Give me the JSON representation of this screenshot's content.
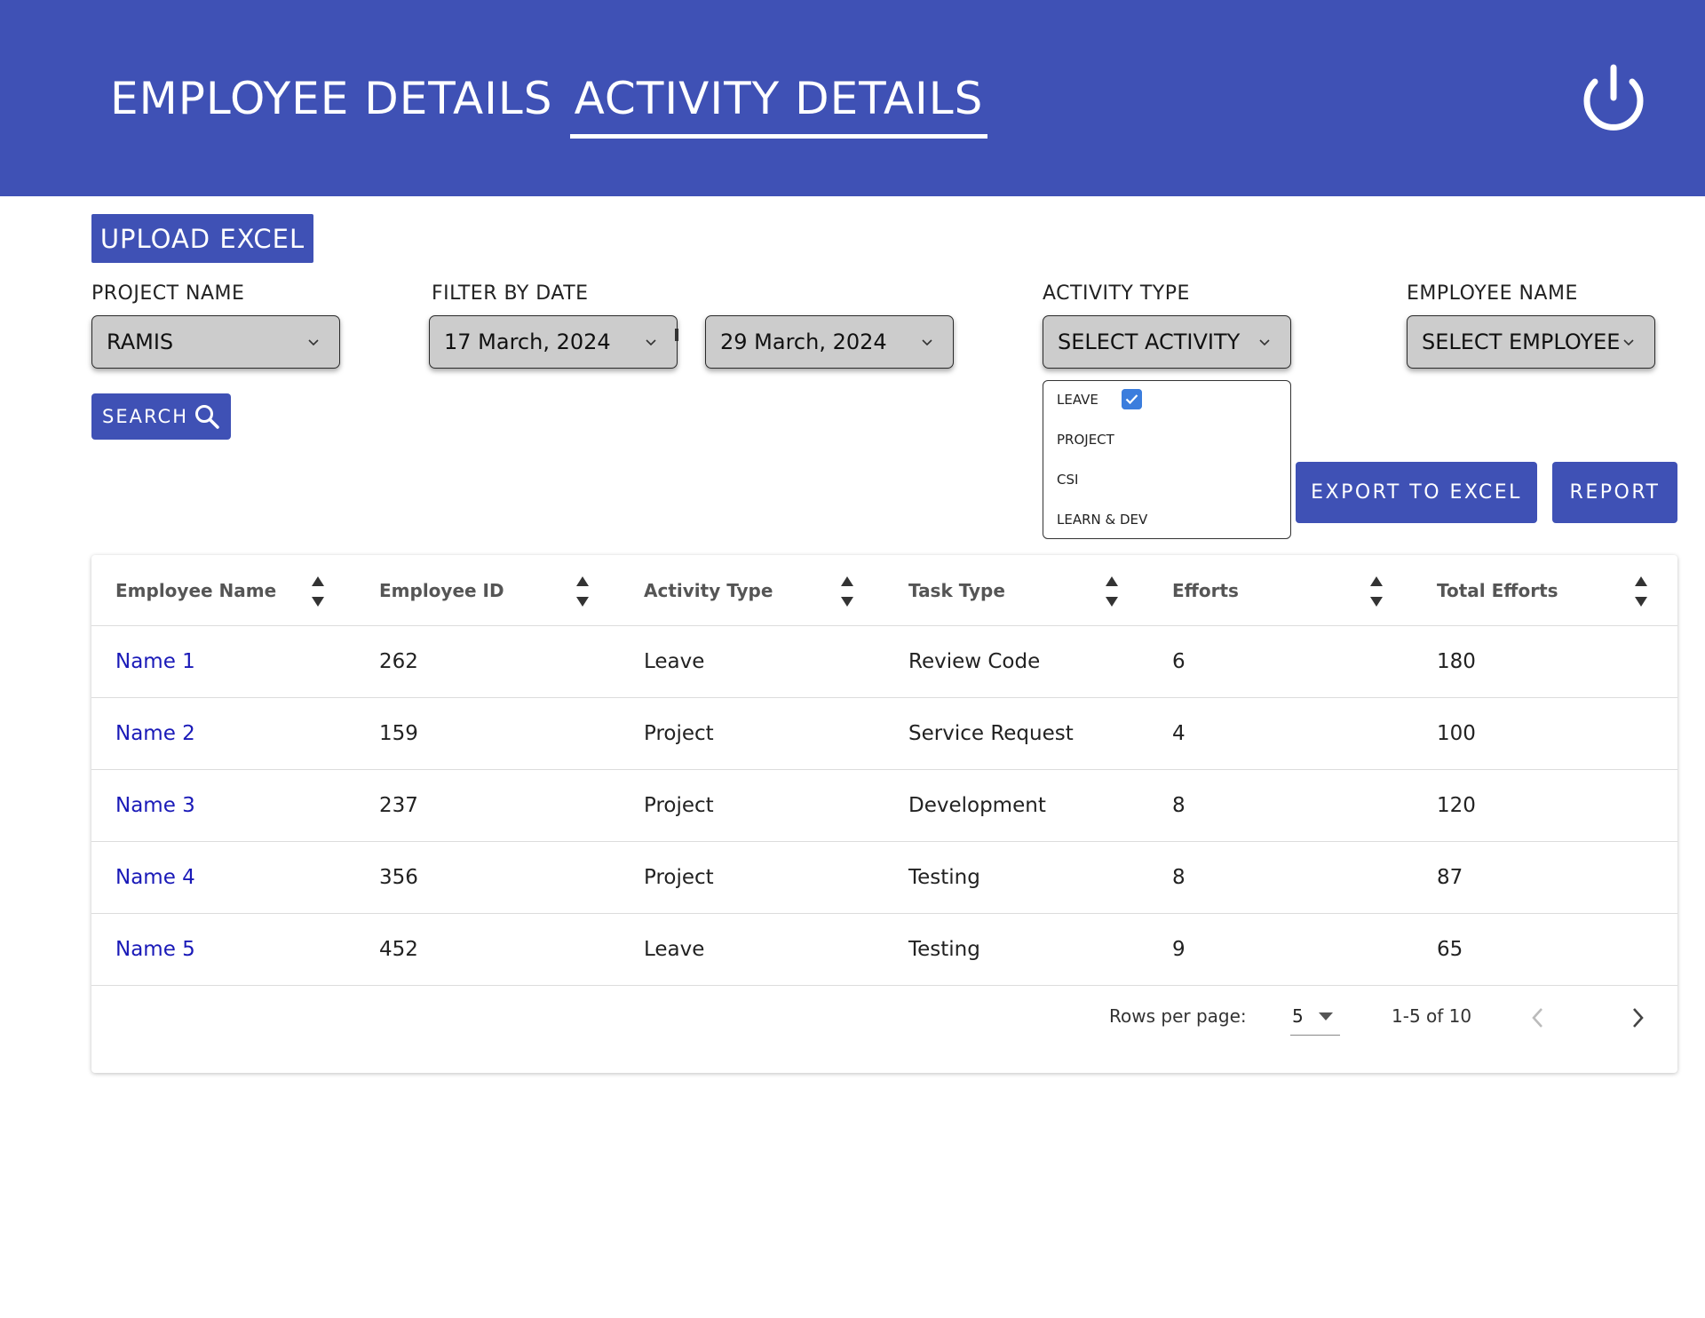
{
  "header": {
    "tabs": [
      {
        "label": "EMPLOYEE DETAILS",
        "active": false
      },
      {
        "label": "ACTIVITY DETAILS",
        "active": true
      }
    ],
    "power_icon": "power-icon",
    "accent_color": "#3f51b5"
  },
  "toolbar": {
    "upload_label": "UPLOAD EXCEL",
    "search_label": "SEARCH",
    "export_label": "EXPORT TO EXCEL",
    "report_label": "REPORT"
  },
  "filters": {
    "project": {
      "label": "PROJECT NAME",
      "value": "RAMIS"
    },
    "date": {
      "label": "FILTER BY DATE",
      "from": "17 March, 2024",
      "to": "29 March, 2024"
    },
    "activity": {
      "label": "ACTIVITY TYPE",
      "value": "SELECT ACTIVITY",
      "options": [
        {
          "label": "LEAVE",
          "checked": true
        },
        {
          "label": "PROJECT",
          "checked": false
        },
        {
          "label": "CSI",
          "checked": false
        },
        {
          "label": "LEARN & DEV",
          "checked": false
        }
      ]
    },
    "employee": {
      "label": "EMPLOYEE NAME",
      "value": "SELECT EMPLOYEE"
    }
  },
  "table": {
    "columns": [
      "Employee Name",
      "Employee ID",
      "Activity Type",
      "Task Type",
      "Efforts",
      "Total Efforts"
    ],
    "rows": [
      {
        "name": "Name 1",
        "id": "262",
        "activity": "Leave",
        "task": "Review Code",
        "efforts": "6",
        "total": "180"
      },
      {
        "name": "Name 2",
        "id": "159",
        "activity": "Project",
        "task": "Service Request",
        "efforts": "4",
        "total": "100"
      },
      {
        "name": "Name 3",
        "id": "237",
        "activity": "Project",
        "task": "Development",
        "efforts": "8",
        "total": "120"
      },
      {
        "name": "Name 4",
        "id": "356",
        "activity": "Project",
        "task": "Testing",
        "efforts": "8",
        "total": "87"
      },
      {
        "name": "Name 5",
        "id": "452",
        "activity": "Leave",
        "task": "Testing",
        "efforts": "9",
        "total": "65"
      }
    ]
  },
  "pagination": {
    "rows_per_page_label": "Rows per page:",
    "rows_per_page": "5",
    "range": "1-5 of 10"
  }
}
